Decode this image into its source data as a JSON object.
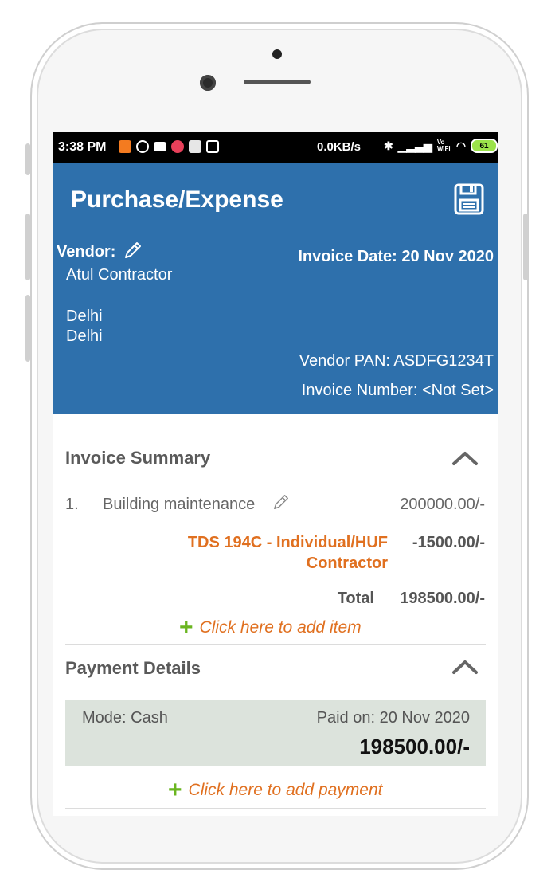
{
  "status_bar": {
    "time": "3:38 PM",
    "speed": "0.0KB/s",
    "network": "Vo WiFi",
    "battery": "61",
    "icons": [
      "mi-icon",
      "ring-icon",
      "paytm-icon",
      "record-icon",
      "app-icon",
      "calendar-icon",
      "bluetooth-icon",
      "signal-icon",
      "wifi-icon",
      "charging-icon"
    ]
  },
  "header": {
    "title": "Purchase/Expense",
    "save_icon": "save-icon",
    "vendor_label": "Vendor:",
    "vendor_name": "Atul Contractor",
    "vendor_city": "Delhi",
    "vendor_state": "Delhi",
    "invoice_date": "Invoice Date: 20 Nov 2020",
    "vendor_pan": "Vendor PAN: ASDFG1234T",
    "invoice_number": "Invoice Number: <Not Set>",
    "background_color": "#2e70ac"
  },
  "invoice_summary": {
    "title": "Invoice Summary",
    "items": [
      {
        "index": "1.",
        "name": "Building maintenance",
        "amount": "200000.00/-"
      }
    ],
    "tds_label": "TDS 194C - Individual/HUF Contractor",
    "tds_amount": "-1500.00/-",
    "total_label": "Total",
    "total_amount": "198500.00/-",
    "add_item_label": "Click here to add item"
  },
  "payment_details": {
    "title": "Payment Details",
    "mode": "Mode: Cash",
    "paid_on": "Paid on: 20 Nov 2020",
    "amount": "198500.00/-",
    "add_payment_label": "Click here to add payment"
  },
  "colors": {
    "accent_orange": "#e07020",
    "plus_green": "#6ab520",
    "payment_bg": "#dce3dc"
  }
}
